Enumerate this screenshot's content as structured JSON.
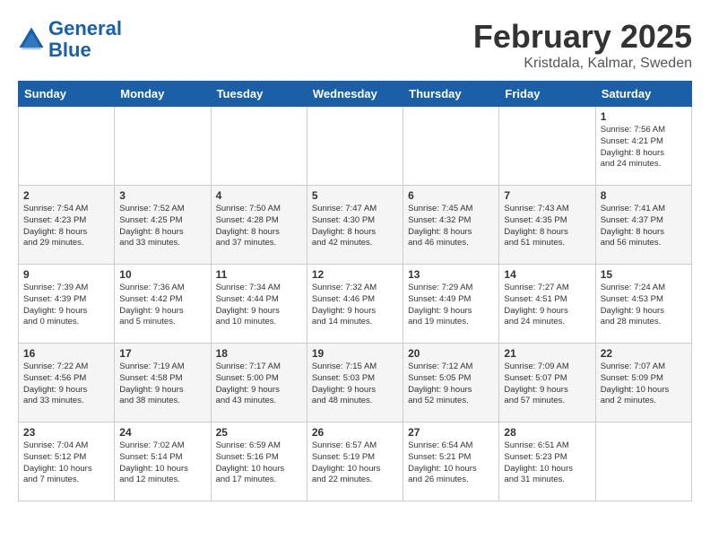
{
  "header": {
    "logo_line1": "General",
    "logo_line2": "Blue",
    "title": "February 2025",
    "subtitle": "Kristdala, Kalmar, Sweden"
  },
  "weekdays": [
    "Sunday",
    "Monday",
    "Tuesday",
    "Wednesday",
    "Thursday",
    "Friday",
    "Saturday"
  ],
  "weeks": [
    [
      {
        "day": "",
        "info": ""
      },
      {
        "day": "",
        "info": ""
      },
      {
        "day": "",
        "info": ""
      },
      {
        "day": "",
        "info": ""
      },
      {
        "day": "",
        "info": ""
      },
      {
        "day": "",
        "info": ""
      },
      {
        "day": "1",
        "info": "Sunrise: 7:56 AM\nSunset: 4:21 PM\nDaylight: 8 hours\nand 24 minutes."
      }
    ],
    [
      {
        "day": "2",
        "info": "Sunrise: 7:54 AM\nSunset: 4:23 PM\nDaylight: 8 hours\nand 29 minutes."
      },
      {
        "day": "3",
        "info": "Sunrise: 7:52 AM\nSunset: 4:25 PM\nDaylight: 8 hours\nand 33 minutes."
      },
      {
        "day": "4",
        "info": "Sunrise: 7:50 AM\nSunset: 4:28 PM\nDaylight: 8 hours\nand 37 minutes."
      },
      {
        "day": "5",
        "info": "Sunrise: 7:47 AM\nSunset: 4:30 PM\nDaylight: 8 hours\nand 42 minutes."
      },
      {
        "day": "6",
        "info": "Sunrise: 7:45 AM\nSunset: 4:32 PM\nDaylight: 8 hours\nand 46 minutes."
      },
      {
        "day": "7",
        "info": "Sunrise: 7:43 AM\nSunset: 4:35 PM\nDaylight: 8 hours\nand 51 minutes."
      },
      {
        "day": "8",
        "info": "Sunrise: 7:41 AM\nSunset: 4:37 PM\nDaylight: 8 hours\nand 56 minutes."
      }
    ],
    [
      {
        "day": "9",
        "info": "Sunrise: 7:39 AM\nSunset: 4:39 PM\nDaylight: 9 hours\nand 0 minutes."
      },
      {
        "day": "10",
        "info": "Sunrise: 7:36 AM\nSunset: 4:42 PM\nDaylight: 9 hours\nand 5 minutes."
      },
      {
        "day": "11",
        "info": "Sunrise: 7:34 AM\nSunset: 4:44 PM\nDaylight: 9 hours\nand 10 minutes."
      },
      {
        "day": "12",
        "info": "Sunrise: 7:32 AM\nSunset: 4:46 PM\nDaylight: 9 hours\nand 14 minutes."
      },
      {
        "day": "13",
        "info": "Sunrise: 7:29 AM\nSunset: 4:49 PM\nDaylight: 9 hours\nand 19 minutes."
      },
      {
        "day": "14",
        "info": "Sunrise: 7:27 AM\nSunset: 4:51 PM\nDaylight: 9 hours\nand 24 minutes."
      },
      {
        "day": "15",
        "info": "Sunrise: 7:24 AM\nSunset: 4:53 PM\nDaylight: 9 hours\nand 28 minutes."
      }
    ],
    [
      {
        "day": "16",
        "info": "Sunrise: 7:22 AM\nSunset: 4:56 PM\nDaylight: 9 hours\nand 33 minutes."
      },
      {
        "day": "17",
        "info": "Sunrise: 7:19 AM\nSunset: 4:58 PM\nDaylight: 9 hours\nand 38 minutes."
      },
      {
        "day": "18",
        "info": "Sunrise: 7:17 AM\nSunset: 5:00 PM\nDaylight: 9 hours\nand 43 minutes."
      },
      {
        "day": "19",
        "info": "Sunrise: 7:15 AM\nSunset: 5:03 PM\nDaylight: 9 hours\nand 48 minutes."
      },
      {
        "day": "20",
        "info": "Sunrise: 7:12 AM\nSunset: 5:05 PM\nDaylight: 9 hours\nand 52 minutes."
      },
      {
        "day": "21",
        "info": "Sunrise: 7:09 AM\nSunset: 5:07 PM\nDaylight: 9 hours\nand 57 minutes."
      },
      {
        "day": "22",
        "info": "Sunrise: 7:07 AM\nSunset: 5:09 PM\nDaylight: 10 hours\nand 2 minutes."
      }
    ],
    [
      {
        "day": "23",
        "info": "Sunrise: 7:04 AM\nSunset: 5:12 PM\nDaylight: 10 hours\nand 7 minutes."
      },
      {
        "day": "24",
        "info": "Sunrise: 7:02 AM\nSunset: 5:14 PM\nDaylight: 10 hours\nand 12 minutes."
      },
      {
        "day": "25",
        "info": "Sunrise: 6:59 AM\nSunset: 5:16 PM\nDaylight: 10 hours\nand 17 minutes."
      },
      {
        "day": "26",
        "info": "Sunrise: 6:57 AM\nSunset: 5:19 PM\nDaylight: 10 hours\nand 22 minutes."
      },
      {
        "day": "27",
        "info": "Sunrise: 6:54 AM\nSunset: 5:21 PM\nDaylight: 10 hours\nand 26 minutes."
      },
      {
        "day": "28",
        "info": "Sunrise: 6:51 AM\nSunset: 5:23 PM\nDaylight: 10 hours\nand 31 minutes."
      },
      {
        "day": "",
        "info": ""
      }
    ]
  ]
}
